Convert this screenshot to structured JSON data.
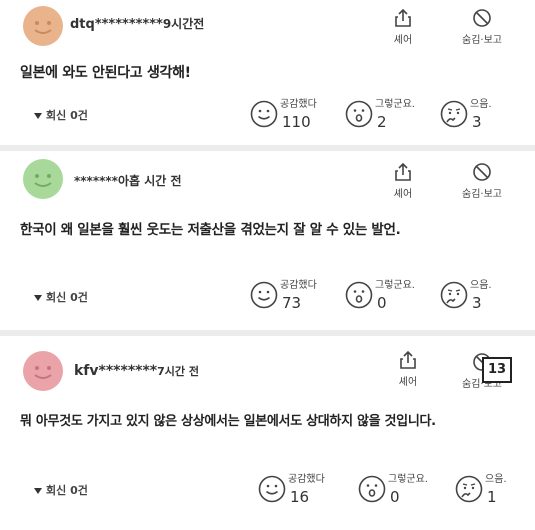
{
  "comments": [
    {
      "author": "dtq**********",
      "time": "9시간전",
      "text": "일본에 와도 안된다고 생각해!",
      "avatar_color": "#e9b48c",
      "share_label": "셰어",
      "hide_label": "숨김·보고",
      "replies_label": "회신 0건",
      "reactions": [
        {
          "label": "공감했다",
          "count": "110"
        },
        {
          "label": "그렇군요.",
          "count": "2"
        },
        {
          "label": "으음.",
          "count": "3"
        }
      ]
    },
    {
      "author": "*******",
      "time": "아홉 시간 전",
      "text": "한국이 왜 일본을 훨씬 웃도는 저출산을 겪었는지 잘 알 수 있는 발언.",
      "avatar_color": "#a8d99a",
      "share_label": "셰어",
      "hide_label": "숨김·보고",
      "replies_label": "회신 0건",
      "reactions": [
        {
          "label": "공감했다",
          "count": "73"
        },
        {
          "label": "그렇군요.",
          "count": "0"
        },
        {
          "label": "으음.",
          "count": "3"
        }
      ]
    },
    {
      "author": "kfv********",
      "time": "7시간 전",
      "text": "뭐 아무것도 가지고 있지 않은 상상에서는 일본에서도 상대하지 않을 것입니다.",
      "avatar_color": "#eaa3a8",
      "share_label": "셰어",
      "hide_label": "숨김·보고",
      "replies_label": "회신 0건",
      "reactions": [
        {
          "label": "공감했다",
          "count": "16"
        },
        {
          "label": "그렇군요.",
          "count": "0"
        },
        {
          "label": "으음.",
          "count": "1"
        }
      ]
    }
  ],
  "badge": "13"
}
